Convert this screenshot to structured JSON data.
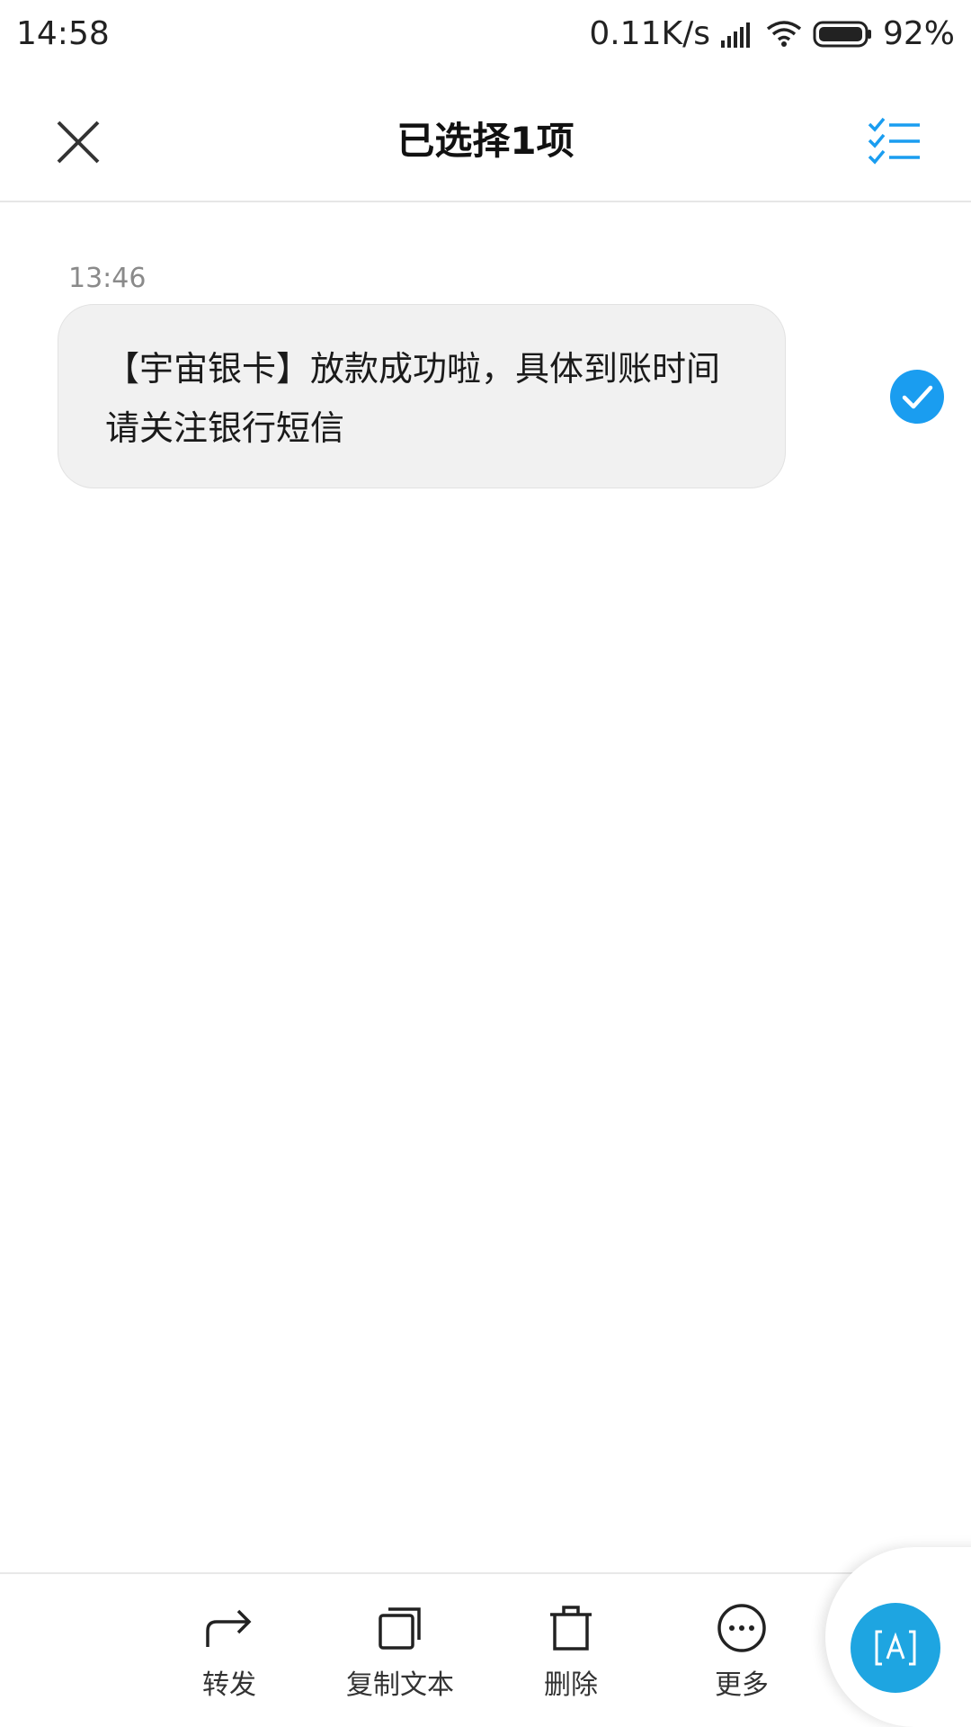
{
  "status_bar": {
    "time": "14:58",
    "network_speed": "0.11K/s",
    "battery_percent": "92%",
    "icons": [
      "signal-icon",
      "wifi-icon",
      "battery-icon"
    ]
  },
  "header": {
    "title": "已选择1项",
    "close_icon": "close-icon",
    "select_all_icon": "checklist-icon"
  },
  "message": {
    "time": "13:46",
    "text": "【宇宙银卡】放款成功啦，具体到账时间请关注银行短信",
    "selected": true
  },
  "actions": [
    {
      "label": "转发",
      "icon": "forward-icon"
    },
    {
      "label": "复制文本",
      "icon": "copy-icon"
    },
    {
      "label": "删除",
      "icon": "trash-icon"
    },
    {
      "label": "更多",
      "icon": "more-icon"
    }
  ],
  "fab": {
    "icon": "translate-icon"
  },
  "colors": {
    "accent": "#1ea5e1",
    "check": "#1a9df0",
    "bubble": "#f1f1f1"
  }
}
